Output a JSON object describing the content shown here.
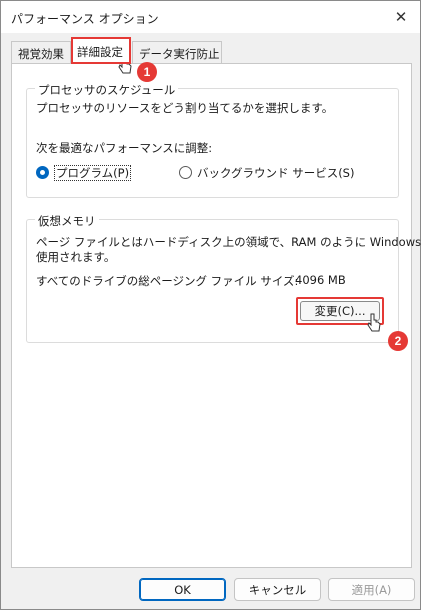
{
  "window": {
    "title": "パフォーマンス オプション",
    "close_glyph": "✕"
  },
  "tabs": [
    {
      "label": "視覚効果",
      "selected": false
    },
    {
      "label": "詳細設定",
      "selected": true
    },
    {
      "label": "データ実行防止",
      "selected": false
    }
  ],
  "processor": {
    "legend": "プロセッサのスケジュール",
    "description": "プロセッサのリソースをどう割り当てるかを選択します。",
    "adjust_label": "次を最適なパフォーマンスに調整:",
    "options": [
      {
        "label": "プログラム(P)",
        "checked": true
      },
      {
        "label": "バックグラウンド サービス(S)",
        "checked": false
      }
    ]
  },
  "virtual_memory": {
    "legend": "仮想メモリ",
    "description_line1": "ページ ファイルとはハードディスク上の領域で、RAM のように Windows で",
    "description_line2": "使用されます。",
    "total_label": "すべてのドライブの総ページング ファイル サイズ:",
    "total_value": "4096 MB",
    "change_button": "変更(C)..."
  },
  "footer": {
    "ok": "OK",
    "cancel": "キャンセル",
    "apply": "適用(A)"
  },
  "annotations": {
    "step1": "1",
    "step2": "2",
    "highlight_color": "#e53935"
  },
  "colors": {
    "accent": "#0067c0"
  }
}
